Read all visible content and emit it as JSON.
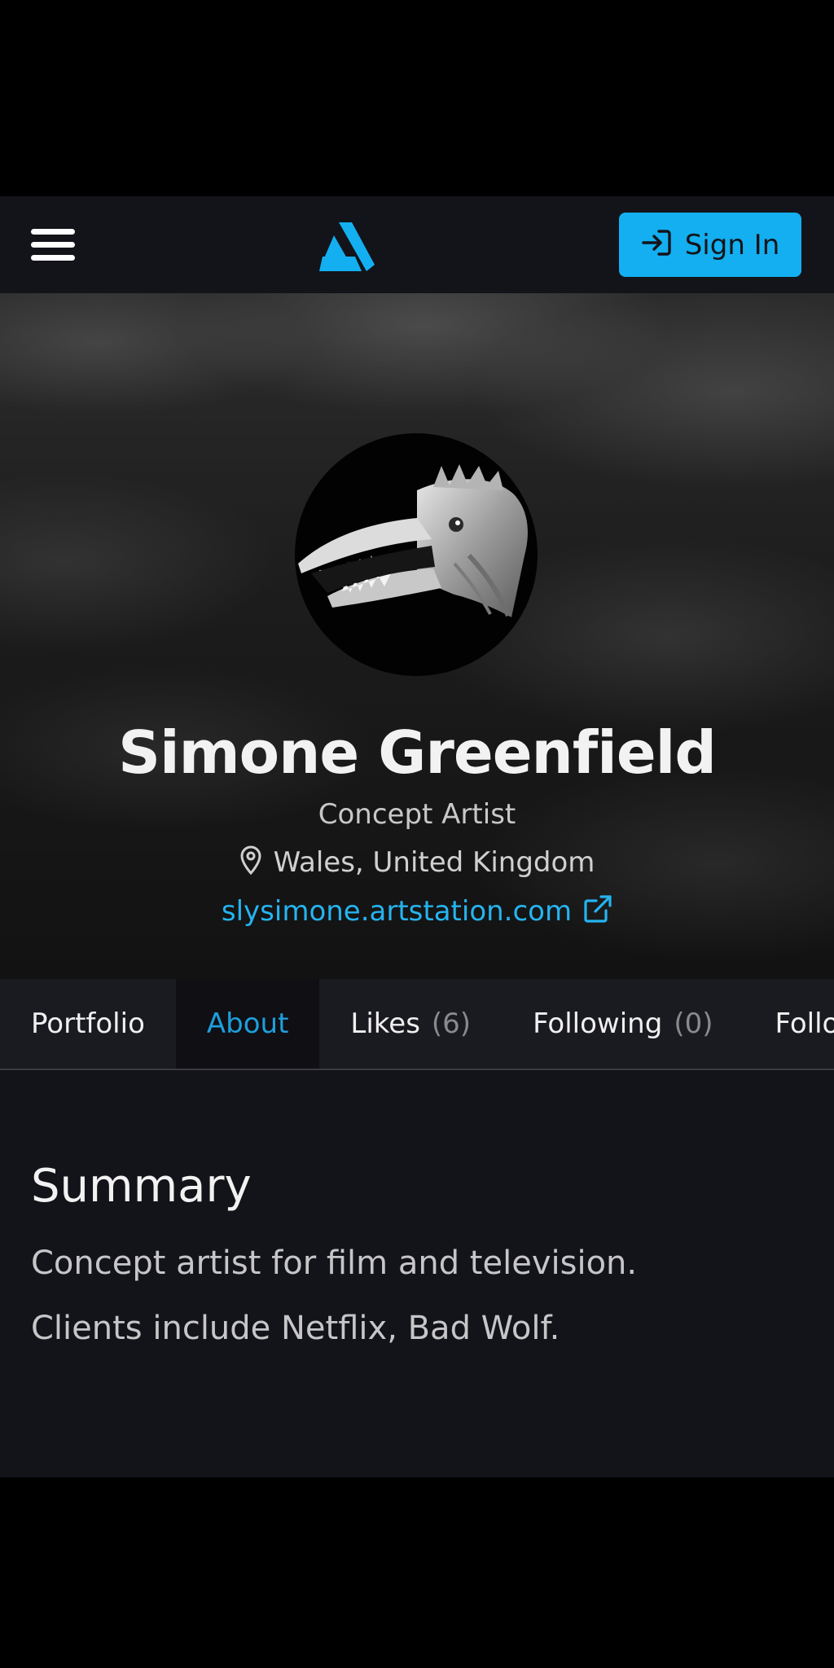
{
  "header": {
    "menu_icon": "hamburger-menu-icon",
    "logo_icon": "artstation-logo-icon",
    "sign_in_icon": "sign-in-arrow-icon",
    "sign_in_label": "Sign In",
    "accent_color": "#13aff0"
  },
  "profile": {
    "name": "Simone Greenfield",
    "headline": "Concept Artist",
    "location_icon": "map-pin-icon",
    "location": "Wales, United Kingdom",
    "website": "slysimone.artstation.com",
    "website_icon": "external-link-icon"
  },
  "tabs": [
    {
      "label": "Portfolio",
      "count": "",
      "active": false
    },
    {
      "label": "About",
      "count": "",
      "active": true
    },
    {
      "label": "Likes",
      "count": "(6)",
      "active": false
    },
    {
      "label": "Following",
      "count": "(0)",
      "active": false
    },
    {
      "label": "Followers",
      "count": "",
      "active": false
    }
  ],
  "about": {
    "section_title": "Summary",
    "summary_lines": [
      "Concept artist for film and television.",
      "Clients include Netflix, Bad Wolf."
    ]
  }
}
